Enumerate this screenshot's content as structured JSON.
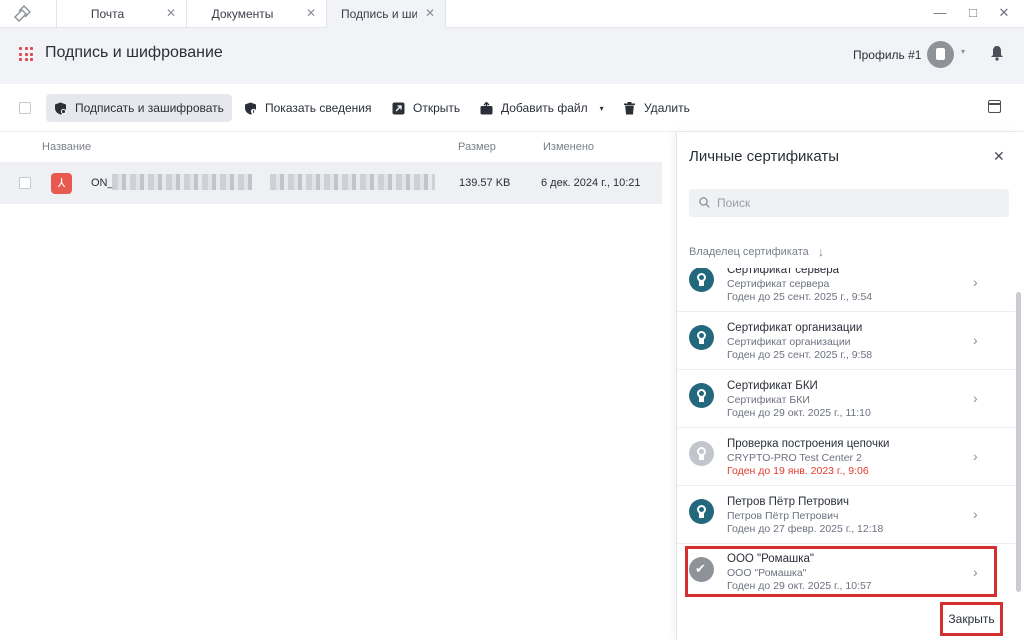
{
  "tabs": [
    {
      "label": "Почта",
      "close": "✕"
    },
    {
      "label": "Документы",
      "close": "✕"
    },
    {
      "label": "Подпись и шифр",
      "close": "✕"
    }
  ],
  "window_controls": {
    "minimize": "—",
    "maximize": "□",
    "close": "✕"
  },
  "header": {
    "title": "Подпись и шифрование",
    "profile": "Профиль #1",
    "caret": "▾"
  },
  "toolbar": {
    "sign_encrypt": "Подписать и зашифровать",
    "show_details": "Показать сведения",
    "open": "Открыть",
    "add_file": "Добавить файл",
    "add_file_caret": "▾",
    "delete": "Удалить"
  },
  "filelist": {
    "columns": {
      "name": "Название",
      "size": "Размер",
      "modified": "Изменено"
    },
    "rows": [
      {
        "icon": "pdf-icon",
        "icon_glyph": "⅄",
        "name_prefix": "ON_",
        "size": "139.57 KB",
        "modified": "6 дек. 2024 г., 10:21"
      }
    ]
  },
  "cert_panel": {
    "title": "Личные сертификаты",
    "close": "✕",
    "search_placeholder": "Поиск",
    "sort_label": "Владелец сертификата",
    "sort_arrow": "↓",
    "chevron": "›",
    "items": [
      {
        "name": "Сертификат сервера",
        "issuer": "Сертификат сервера",
        "valid": "Годен до 25 сент. 2025 г., 9:54",
        "expired": false,
        "status": "valid"
      },
      {
        "name": "Сертификат организации",
        "issuer": "Сертификат организации",
        "valid": "Годен до 25 сент. 2025 г., 9:58",
        "expired": false,
        "status": "valid"
      },
      {
        "name": "Сертификат БКИ",
        "issuer": "Сертификат БКИ",
        "valid": "Годен до 29 окт. 2025 г., 11:10",
        "expired": false,
        "status": "valid"
      },
      {
        "name": "Проверка построения цепочки",
        "issuer": "CRYPTO-PRO Test Center 2",
        "valid": "Годен до 19 янв. 2023 г., 9:06",
        "expired": true,
        "status": "expired"
      },
      {
        "name": "Петров Пётр Петрович",
        "issuer": "Петров Пётр Петрович",
        "valid": "Годен до 27 февр. 2025 г., 12:18",
        "expired": false,
        "status": "valid"
      },
      {
        "name": "ООО \"Ромашка\"",
        "issuer": "ООО \"Ромашка\"",
        "valid": "Годен до 29 окт. 2025 г., 10:57",
        "expired": false,
        "status": "selected"
      }
    ],
    "close_button": "Закрыть"
  },
  "colors": {
    "accent": "#e0474c",
    "cert_teal": "#24687d",
    "expired_red": "#e03a2f",
    "highlight_red": "#d32f2f"
  }
}
